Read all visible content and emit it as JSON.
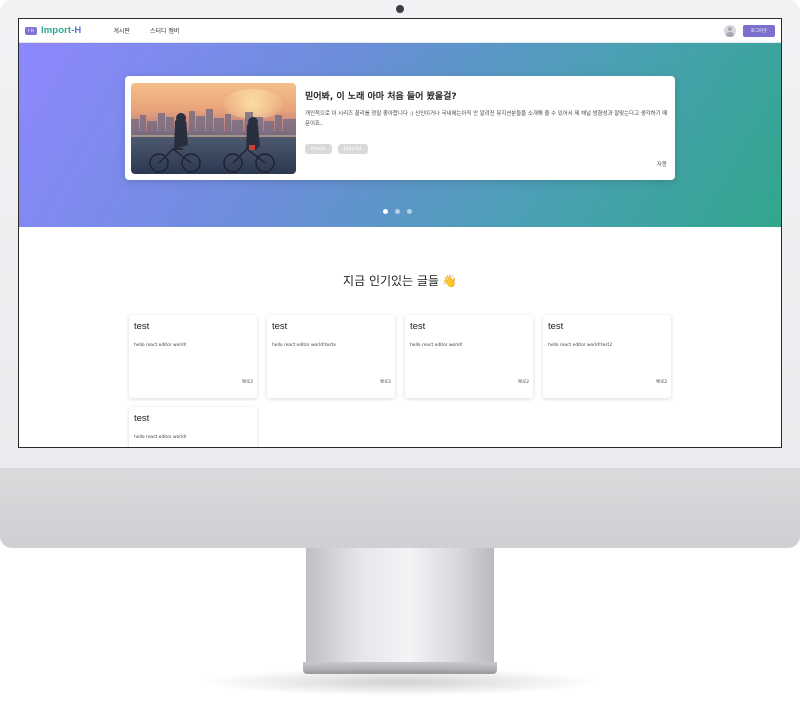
{
  "navbar": {
    "logo_mark": "I-H",
    "logo_text_1": "Import",
    "logo_text_2": "-H",
    "items": [
      "게시판",
      "스터디 멤버"
    ],
    "logout_label": "로그아웃"
  },
  "hero": {
    "title": "믿어봐, 이 노래 아마 처음 들어 봤을걸?",
    "description": "개인적으로 이 시리즈 꼴리를 정말 좋아합니다 :) 신인이거나 국내에는아직 안 알려진 뮤지션분들을 소개해 줄 수 있어서 제 채널 방향성과 잘맞는다고 생각하기 때문이죠..",
    "tags": [
      "music",
      "playlist"
    ],
    "author": "자몽",
    "slides": 3,
    "active_slide": 1
  },
  "popular": {
    "heading": "지금 인기있는 글들",
    "emoji": "👋",
    "posts": [
      {
        "title": "test",
        "body": "hello react editor world!",
        "author": "뽀로2"
      },
      {
        "title": "test",
        "body": "hello react editor world!testx",
        "author": "뽀로2"
      },
      {
        "title": "test",
        "body": "hello react editor world!",
        "author": "뽀로2"
      },
      {
        "title": "test",
        "body": "hello react editor world!test2",
        "author": "뽀로2"
      },
      {
        "title": "test",
        "body": "hello react editor world!",
        "author": ""
      }
    ]
  },
  "colors": {
    "brand": "#7b6fcf",
    "logo_green": "#31a796",
    "hero_start": "#8e87ff",
    "hero_end": "#31a68c"
  }
}
